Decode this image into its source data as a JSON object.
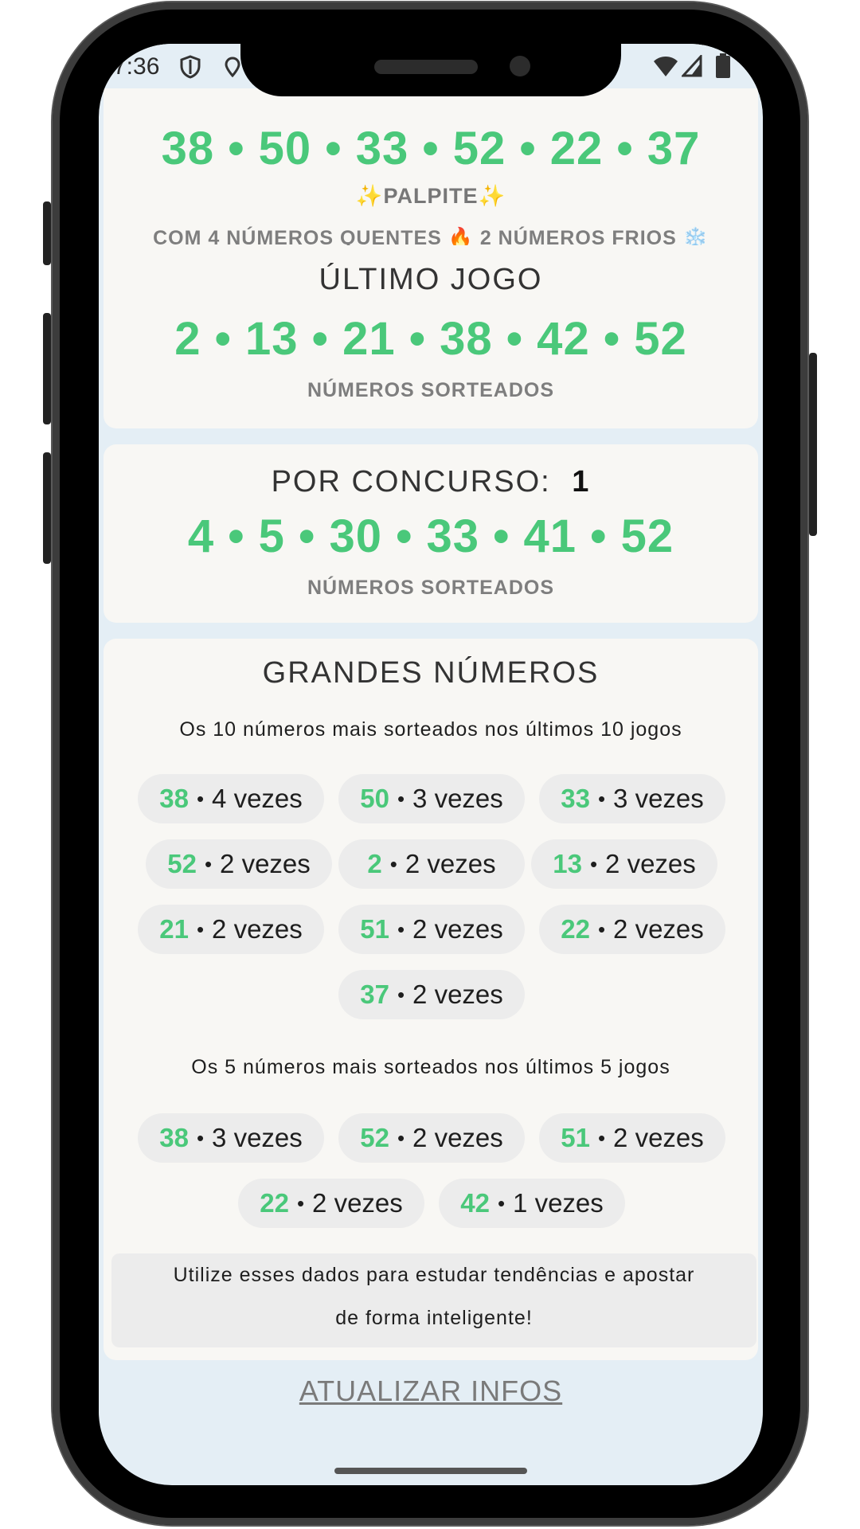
{
  "status_bar": {
    "time": "7:36"
  },
  "palpite": {
    "numbers": "38 • 50 • 33 • 52 • 22 • 37",
    "title": "✨PALPITE✨",
    "caption": "COM 4 NÚMEROS QUENTES 🔥 2 NÚMEROS FRIOS ❄️"
  },
  "ultimo_jogo": {
    "title": "ÚLTIMO JOGO",
    "numbers": "2 • 13 • 21 • 38 • 42 • 52",
    "caption": "NÚMEROS SORTEADOS"
  },
  "por_concurso": {
    "label": "POR CONCURSO:",
    "value": "1",
    "numbers": "4 • 5 • 30 • 33 • 41 • 52",
    "caption": "NÚMEROS SORTEADOS"
  },
  "grandes_numeros": {
    "title": "GRANDES NÚMEROS",
    "top10_subtitle": "Os 10 números mais sorteados nos últimos 10 jogos",
    "top10": [
      {
        "number": "38",
        "count": "4 vezes"
      },
      {
        "number": "50",
        "count": "3 vezes"
      },
      {
        "number": "33",
        "count": "3 vezes"
      },
      {
        "number": "52",
        "count": "2 vezes"
      },
      {
        "number": "2",
        "count": "2 vezes"
      },
      {
        "number": "13",
        "count": "2 vezes"
      },
      {
        "number": "21",
        "count": "2 vezes"
      },
      {
        "number": "51",
        "count": "2 vezes"
      },
      {
        "number": "22",
        "count": "2 vezes"
      },
      {
        "number": "37",
        "count": "2 vezes"
      }
    ],
    "top5_subtitle": "Os 5 números mais sorteados nos últimos 5 jogos",
    "top5": [
      {
        "number": "38",
        "count": "3 vezes"
      },
      {
        "number": "52",
        "count": "2 vezes"
      },
      {
        "number": "51",
        "count": "2 vezes"
      },
      {
        "number": "22",
        "count": "2 vezes"
      },
      {
        "number": "42",
        "count": "1 vezes"
      }
    ],
    "tip_line1": "Utilize esses dados para estudar tendências e apostar",
    "tip_line2": "de forma inteligente!"
  },
  "separator": "•",
  "update_link": "ATUALIZAR INFOS",
  "colors": {
    "accent": "#4ac87a",
    "background": "#e4eef5",
    "card": "#f8f7f4",
    "pill": "#ececec"
  }
}
